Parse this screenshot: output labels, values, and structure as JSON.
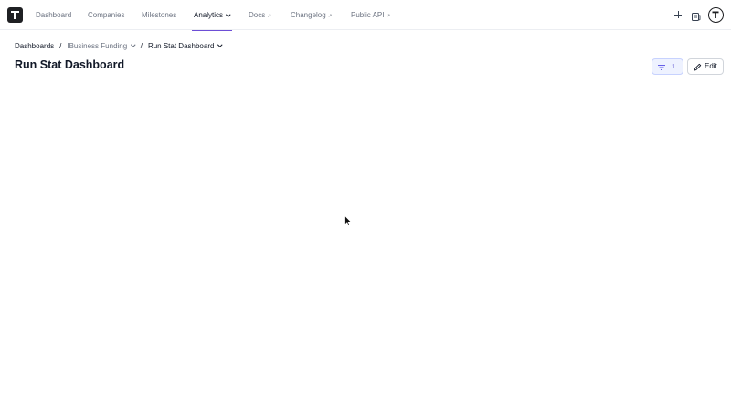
{
  "nav": {
    "items": [
      {
        "label": "Dashboard"
      },
      {
        "label": "Companies"
      },
      {
        "label": "Milestones"
      },
      {
        "label": "Analytics"
      },
      {
        "label": "Docs"
      },
      {
        "label": "Changelog"
      },
      {
        "label": "Public API"
      }
    ],
    "active_item": "Analytics",
    "accent_color": "#6d4ed6"
  },
  "breadcrumb": {
    "root": "Dashboards",
    "separator": "/",
    "group": "IBusiness Funding",
    "current": "Run Stat Dashboard"
  },
  "page": {
    "title": "Run Stat Dashboard"
  },
  "toolbar": {
    "filter_count": "1",
    "edit_label": "Edit"
  }
}
